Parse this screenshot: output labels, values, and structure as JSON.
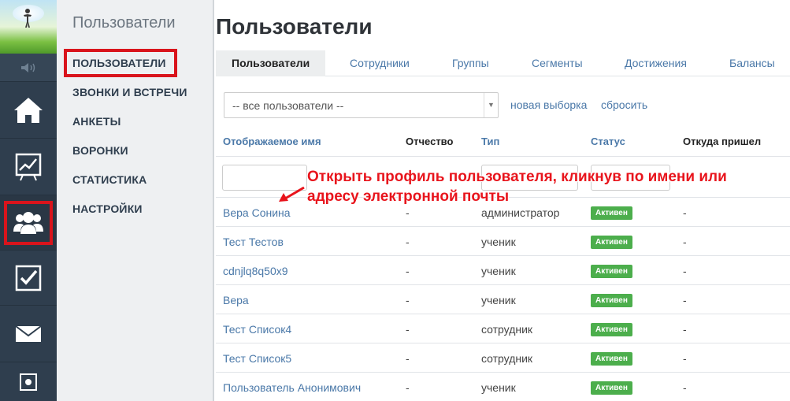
{
  "submenu": {
    "title": "Пользователи",
    "items": [
      {
        "label": "ПОЛЬЗОВАТЕЛИ"
      },
      {
        "label": "ЗВОНКИ И ВСТРЕЧИ"
      },
      {
        "label": "АНКЕТЫ"
      },
      {
        "label": "ВОРОНКИ"
      },
      {
        "label": "СТАТИСТИКА"
      },
      {
        "label": "НАСТРОЙКИ"
      }
    ]
  },
  "rail": {
    "icons": [
      "avatar",
      "speaker-icon",
      "home-icon",
      "chart-icon",
      "users-icon",
      "checkbox-icon",
      "mail-icon",
      "settings-icon"
    ]
  },
  "main": {
    "title": "Пользователи",
    "tabs": [
      {
        "label": "Пользователи"
      },
      {
        "label": "Сотрудники"
      },
      {
        "label": "Группы"
      },
      {
        "label": "Сегменты"
      },
      {
        "label": "Достижения"
      },
      {
        "label": "Балансы"
      }
    ],
    "filter": {
      "selected": "-- все пользователи --",
      "new_selection": "новая выборка",
      "reset": "сбросить"
    },
    "columns": {
      "name": "Отображаемое имя",
      "patronymic": "Отчество",
      "type": "Тип",
      "status": "Статус",
      "source": "Откуда пришел"
    },
    "rows": [
      {
        "name": "Вера Сонина",
        "patronymic": "-",
        "type": "администратор",
        "status": "Активен",
        "source": "-"
      },
      {
        "name": "Тест Тестов",
        "patronymic": "-",
        "type": "ученик",
        "status": "Активен",
        "source": "-"
      },
      {
        "name": "cdnjlq8q50x9",
        "patronymic": "-",
        "type": "ученик",
        "status": "Активен",
        "source": "-"
      },
      {
        "name": "Вера",
        "patronymic": "-",
        "type": "ученик",
        "status": "Активен",
        "source": "-"
      },
      {
        "name": "Тест Список4",
        "patronymic": "-",
        "type": "сотрудник",
        "status": "Активен",
        "source": "-"
      },
      {
        "name": "Тест Список5",
        "patronymic": "-",
        "type": "сотрудник",
        "status": "Активен",
        "source": "-"
      },
      {
        "name": "Пользователь Анонимович",
        "patronymic": "-",
        "type": "ученик",
        "status": "Активен",
        "source": "-"
      }
    ]
  },
  "annotation": {
    "line1": "Открыть профиль пользователя, кликнув по имени или",
    "line2": "адресу электронной почты"
  },
  "colors": {
    "rail": "#2f3e4e",
    "highlight": "#d9141c",
    "link": "#4a78a8",
    "badge": "#4cae4c"
  }
}
